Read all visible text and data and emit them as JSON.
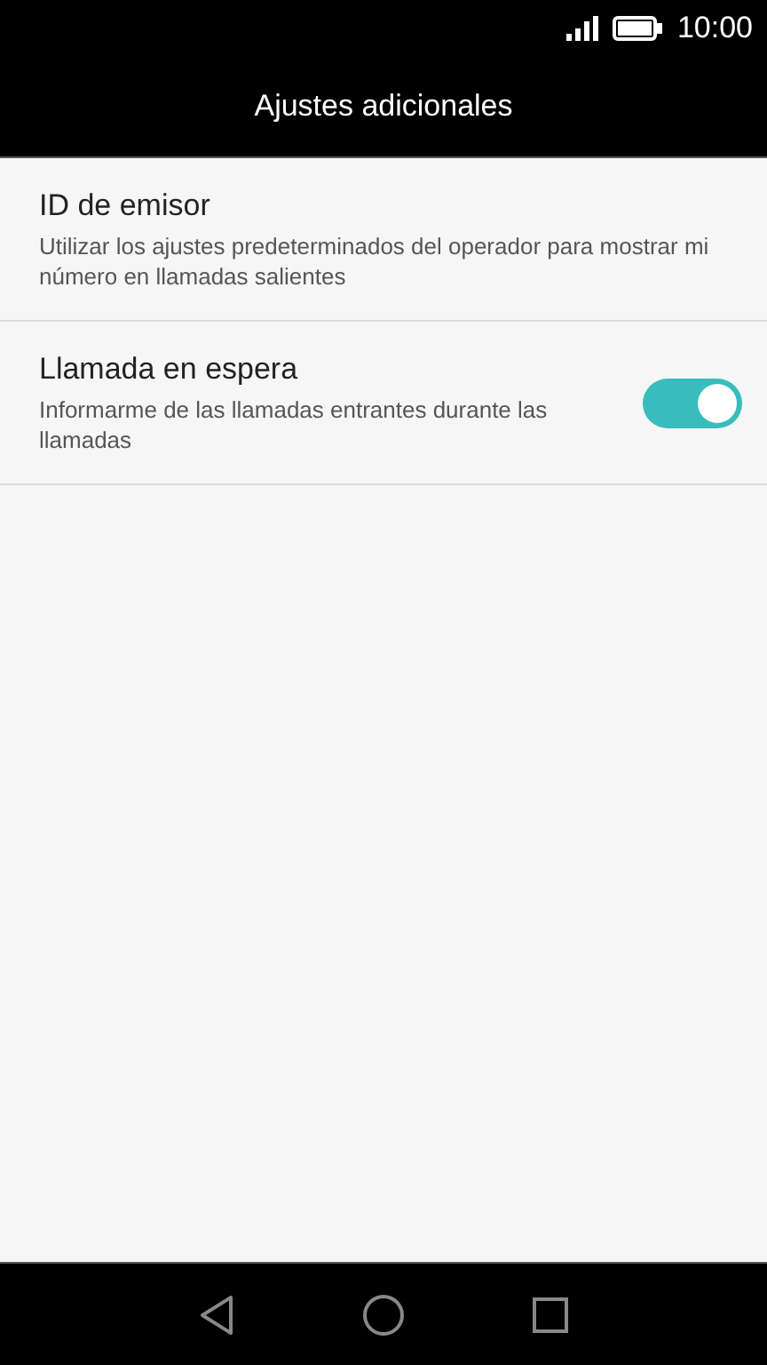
{
  "status_bar": {
    "time": "10:00"
  },
  "title": "Ajustes adicionales",
  "settings": [
    {
      "kind": "plain",
      "title": "ID de emisor",
      "description": "Utilizar los ajustes predeterminados del operador para mostrar mi número en llamadas salientes"
    },
    {
      "kind": "toggle",
      "title": "Llamada en espera",
      "description": "Informarme de las llamadas entrantes durante las llamadas",
      "on": true
    }
  ]
}
